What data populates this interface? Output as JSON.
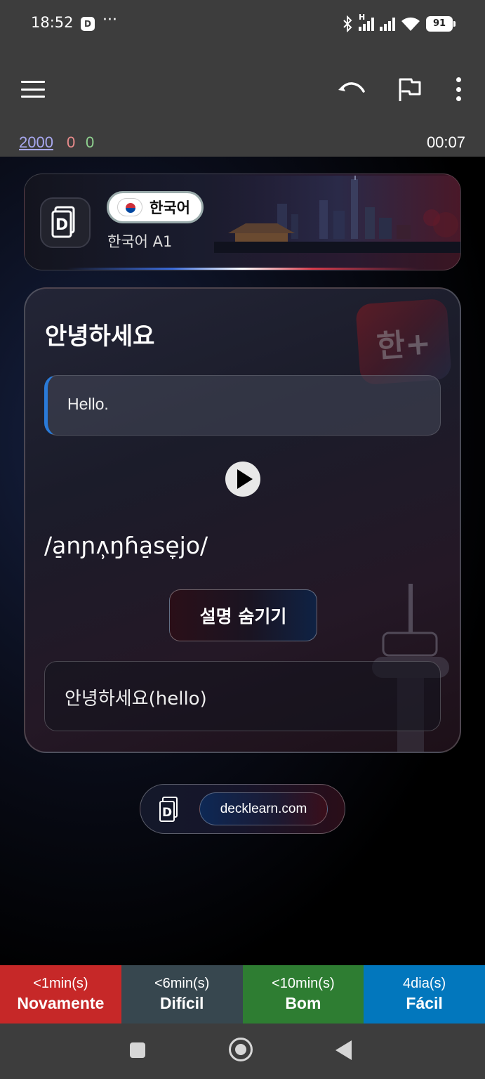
{
  "status_bar": {
    "time": "18:52",
    "app_icon_glyph": "D",
    "overflow_dots": "···",
    "network_label": "H",
    "battery": "91"
  },
  "app_bar": {
    "icons": [
      "menu-icon",
      "undo-icon",
      "flag-icon",
      "more-vert-icon"
    ]
  },
  "counts": {
    "new": "2000",
    "learning": "0",
    "review": "0",
    "timer": "00:07",
    "colors": {
      "new": "#a8a8f0",
      "learning": "#e88b8b",
      "review": "#8fd18f"
    }
  },
  "deck": {
    "language_label": "한국어",
    "deck_name": "한국어 A1"
  },
  "card": {
    "word": "안녕하세요",
    "translation": "Hello.",
    "ipa": "/a̠nɲʌ̹ŋɦa̠se̞jo/",
    "watermark": "한+",
    "hide_button_label": "설명 숨기기",
    "explanation": "안녕하세요(hello)"
  },
  "footer": {
    "link_text": "decklearn.com"
  },
  "answer_buttons": [
    {
      "interval": "<1min(s)",
      "label": "Novamente",
      "color": "#c62828"
    },
    {
      "interval": "<6min(s)",
      "label": "Difícil",
      "color": "#37474f"
    },
    {
      "interval": "<10min(s)",
      "label": "Bom",
      "color": "#2e7d32"
    },
    {
      "interval": "4dia(s)",
      "label": "Fácil",
      "color": "#0277bd"
    }
  ]
}
